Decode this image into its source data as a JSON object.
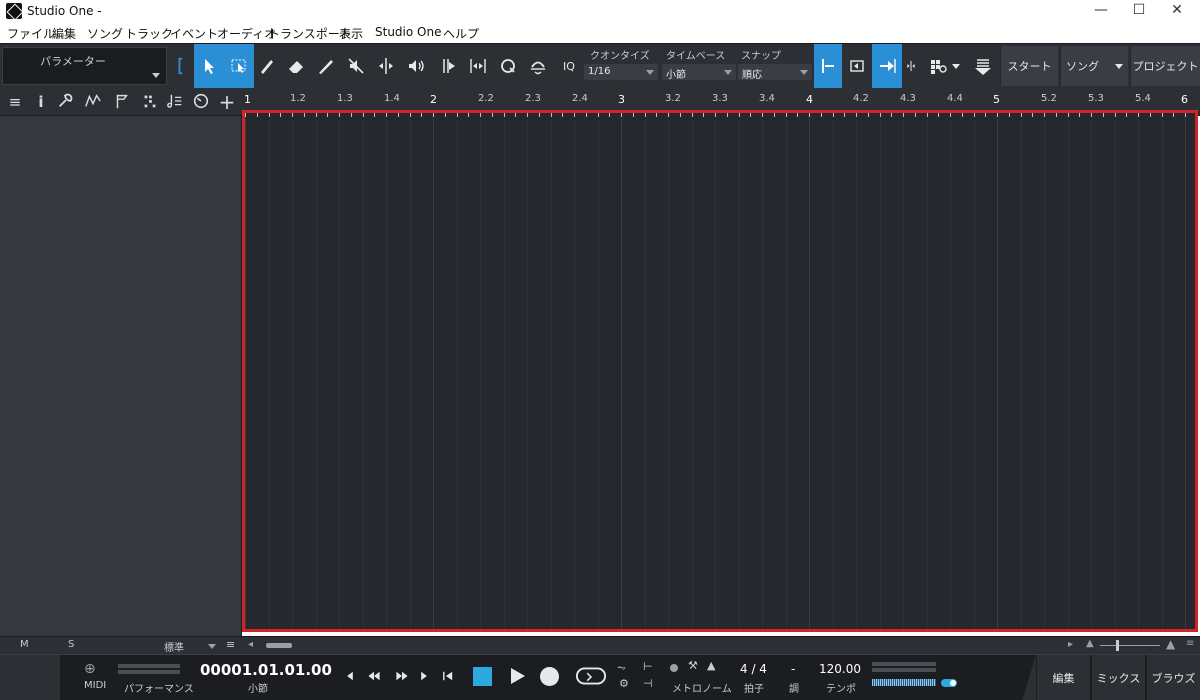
{
  "window": {
    "title": "Studio One -",
    "minimize": "—",
    "maximize": "☐",
    "close": "✕"
  },
  "menu": [
    "ファイル",
    "編集",
    "ソング",
    "トラック",
    "イベント",
    "オーディオ",
    "トランスポート",
    "表示",
    "Studio One",
    "ヘルプ"
  ],
  "toolbar": {
    "parameter_label": "パラメーター",
    "quantize_label": "クオンタイズ",
    "quantize_value": "1/16",
    "timebase_label": "タイムベース",
    "timebase_value": "小節",
    "snap_label": "スナップ",
    "snap_value": "順応",
    "iq_label": "IQ",
    "start_label": "スタート",
    "song_label": "ソング",
    "project_label": "プロジェクト"
  },
  "ruler": {
    "labels": [
      "1",
      "1.2",
      "1.3",
      "1.4",
      "2",
      "2.2",
      "2.3",
      "2.4",
      "3",
      "3.2",
      "3.3",
      "3.4",
      "4",
      "4.2",
      "4.3",
      "4.4",
      "5",
      "5.2",
      "5.3",
      "5.4",
      "6"
    ]
  },
  "track_footer": {
    "mute": "M",
    "solo": "S",
    "preset": "標準"
  },
  "transport": {
    "midi_label": "MIDI",
    "performance_label": "パフォーマンス",
    "time_value": "00001.01.01.00",
    "time_unit": "小節",
    "metronome_label": "メトロノーム",
    "signature_value": "4 / 4",
    "signature_label": "拍子",
    "key_value": "-",
    "key_label": "調",
    "tempo_value": "120.00",
    "tempo_label": "テンポ",
    "edit_label": "編集",
    "mix_label": "ミックス",
    "browse_label": "ブラウズ"
  },
  "colors": {
    "accent": "#2b8fd6",
    "highlight_border": "#d4222a",
    "panel": "#2c2f34",
    "arrange_bg": "#25282d"
  }
}
